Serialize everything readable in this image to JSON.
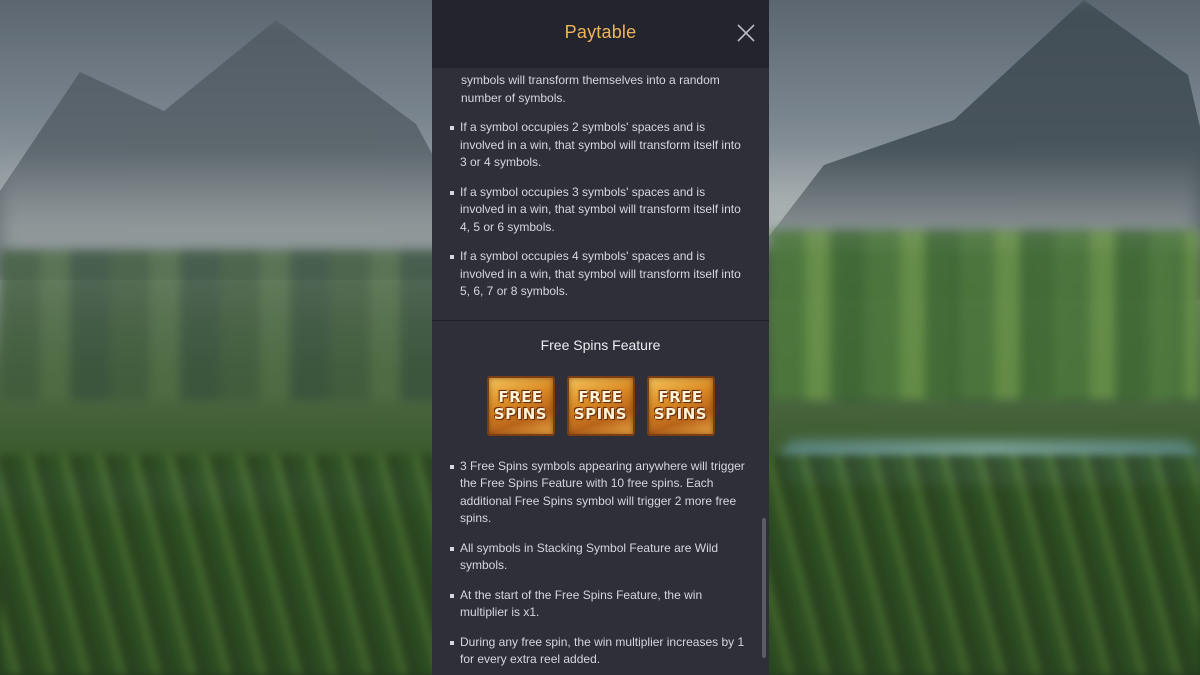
{
  "header": {
    "title": "Paytable"
  },
  "stacking_rules": {
    "continuation": "symbols will transform themselves into a random number of symbols.",
    "items": [
      "If a symbol occupies 2 symbols' spaces and is involved in a win, that symbol will transform itself into 3 or 4 symbols.",
      "If a symbol occupies 3 symbols' spaces and is involved in a win, that symbol will transform itself into 4, 5 or 6 symbols.",
      "If a symbol occupies 4 symbols' spaces and is involved in a win, that symbol will transform itself into 5, 6, 7 or 8 symbols."
    ]
  },
  "free_spins": {
    "title": "Free Spins Feature",
    "icons": [
      {
        "line1": "FREE",
        "line2": "SPINS"
      },
      {
        "line1": "FREE",
        "line2": "SPINS"
      },
      {
        "line1": "FREE",
        "line2": "SPINS"
      }
    ],
    "items": [
      "3 Free Spins symbols appearing anywhere will trigger the Free Spins Feature with 10 free spins. Each additional Free Spins symbol will trigger 2 more free spins.",
      "All symbols in Stacking Symbol Feature are Wild symbols.",
      "At the start of the Free Spins Feature, the win multiplier is x1.",
      "During any free spin, the win multiplier increases by 1 for every extra reel added."
    ]
  },
  "colors": {
    "accent": "#f0b35a",
    "panel": "#2e2f38",
    "header": "#23242c"
  }
}
